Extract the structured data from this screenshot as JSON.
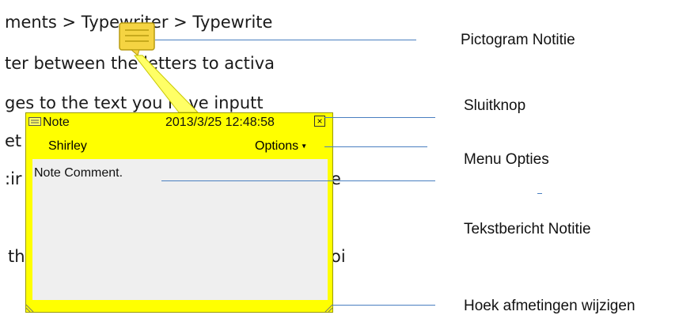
{
  "document": {
    "lines": [
      "ments > Typewriter > Typewrite",
      "ter between the letters to activa",
      "ges to the text you have inputt",
      "et",
      ":ir",
      "th",
      "e",
      "oi"
    ]
  },
  "note": {
    "type_label": "Note",
    "timestamp": "2013/3/25 12:48:58",
    "author": "Shirley",
    "options_label": "Options",
    "comment": "Note Comment.",
    "close_symbol": "×",
    "colors": {
      "background": "#ffff00",
      "body": "#efefef",
      "icon": "#f5d442"
    }
  },
  "callouts": {
    "icon_label": "Pictogram Notitie",
    "close_label": "Sluitknop",
    "options_label": "Menu Opties",
    "message_label": "Tekstbericht Notitie",
    "resize_label": "Hoek afmetingen wijzigen",
    "line_color": "#4a7fc0"
  }
}
